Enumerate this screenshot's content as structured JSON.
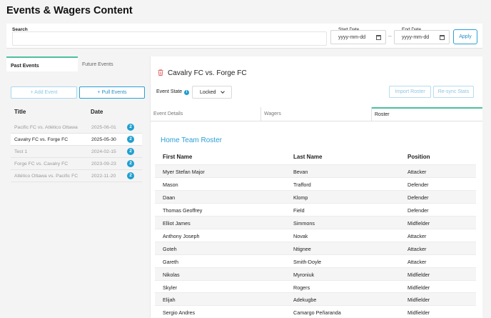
{
  "page_title": "Events & Wagers Content",
  "search": {
    "label": "Search",
    "placeholder": ""
  },
  "date_filter": {
    "start_label": "Start Date",
    "start_value": "yyyy-mm-dd",
    "separator": "--",
    "end_label": "End Date",
    "end_value": "yyyy-mm-dd",
    "apply_label": "Apply"
  },
  "left_tabs": {
    "past": "Past Events",
    "future": "Future Events"
  },
  "left_actions": {
    "add": "+ Add Event",
    "pull": "+ Pull Events"
  },
  "events_table": {
    "headers": {
      "title": "Title",
      "date": "Date"
    },
    "rows": [
      {
        "title": "Pacific FC vs. Atlético Ottawa",
        "date": "2025-06-01",
        "badge": "2"
      },
      {
        "title": "Cavalry FC vs. Forge FC",
        "date": "2025-05-30",
        "badge": "2"
      },
      {
        "title": "Test 1",
        "date": "2024-02-15",
        "badge": "2"
      },
      {
        "title": "Forge FC vs. Cavalry FC",
        "date": "2023-09-23",
        "badge": "2"
      },
      {
        "title": "Atlético Ottawa vs. Pacific FC",
        "date": "2022-11-20",
        "badge": "2"
      }
    ]
  },
  "event_detail": {
    "title": "Cavalry FC vs. Forge FC",
    "state_label": "Event State",
    "state_value": "Locked",
    "import_roster": "Import Roster",
    "resync_stats": "Re-sync Stats"
  },
  "sub_tabs": {
    "details": "Event Details",
    "wagers": "Wagers",
    "roster": "Roster"
  },
  "roster": {
    "heading": "Home Team Roster",
    "headers": {
      "first": "First Name",
      "last": "Last Name",
      "position": "Position"
    },
    "rows": [
      {
        "first": "Myer Stefan Major",
        "last": "Bevan",
        "position": "Attacker"
      },
      {
        "first": "Mason",
        "last": "Trafford",
        "position": "Defender"
      },
      {
        "first": "Daan",
        "last": "Klomp",
        "position": "Defender"
      },
      {
        "first": "Thomas Geoffrey",
        "last": "Field",
        "position": "Defender"
      },
      {
        "first": "Elliot James",
        "last": "Simmons",
        "position": "Midfielder"
      },
      {
        "first": "Anthony Joseph",
        "last": "Novak",
        "position": "Attacker"
      },
      {
        "first": "Goteh",
        "last": "Ntignee",
        "position": "Attacker"
      },
      {
        "first": "Gareth",
        "last": "Smith-Doyle",
        "position": "Attacker"
      },
      {
        "first": "Nikolas",
        "last": "Myroniuk",
        "position": "Midfielder"
      },
      {
        "first": "Skyler",
        "last": "Rogers",
        "position": "Midfielder"
      },
      {
        "first": "Elijah",
        "last": "Adekugbe",
        "position": "Midfielder"
      },
      {
        "first": "Sergio Andres",
        "last": "Camargo Peñaranda",
        "position": "Midfielder"
      }
    ]
  },
  "colors": {
    "accent": "#2a9fd6",
    "tab_indicator": "#4cbfa0",
    "badge": "#1f9fd0",
    "trash": "#e06060"
  }
}
